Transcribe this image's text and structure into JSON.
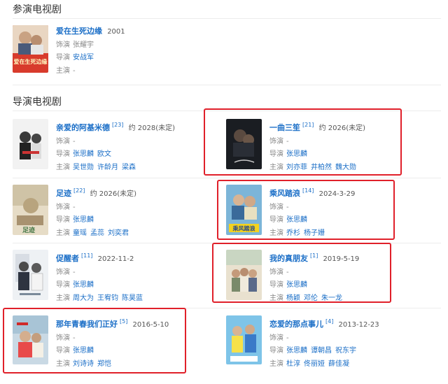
{
  "acted_section": {
    "title": "参演电视剧",
    "items": [
      {
        "title": "爱在生死边缘",
        "year": "2001",
        "cast_label": "饰演",
        "cast": "张耀宇",
        "director_label": "导演",
        "directors": [
          "安战军"
        ],
        "star_label": "主演",
        "stars_empty": "-"
      }
    ]
  },
  "directed_section": {
    "title": "导演电视剧",
    "items": [
      {
        "title": "亲爱的阿基米德",
        "ref": "[23]",
        "date": "约 2028(未定)",
        "role": "-",
        "directors": [
          "张思麟",
          "欧文"
        ],
        "stars": [
          "吴世勋",
          "许龄月",
          "梁森"
        ]
      },
      {
        "title": "一曲三笙",
        "ref": "[21]",
        "date": "约 2026(未定)",
        "role": "-",
        "directors": [
          "张思麟"
        ],
        "stars": [
          "刘亦菲",
          "井柏然",
          "魏大勋"
        ]
      },
      {
        "title": "足迹",
        "ref": "[22]",
        "date": "约 2026(未定)",
        "role": "-",
        "directors": [
          "张思麟"
        ],
        "stars": [
          "童瑶",
          "孟蕊",
          "刘奕君"
        ]
      },
      {
        "title": "乘风踏浪",
        "ref": "[14]",
        "date": "2024-3-29",
        "role": "-",
        "directors": [
          "张思麟"
        ],
        "stars": [
          "乔杉",
          "杨子姗"
        ]
      },
      {
        "title": "促醒者",
        "ref": "[11]",
        "date": "2022-11-2",
        "role": "-",
        "directors": [
          "张思麟"
        ],
        "stars": [
          "周大为",
          "王宥钧",
          "陈昊蓝"
        ]
      },
      {
        "title": "我的真朋友",
        "ref": "[1]",
        "date": "2019-5-19",
        "role": "-",
        "directors": [
          "张思麟"
        ],
        "stars": [
          "杨颖",
          "邓伦",
          "朱一龙"
        ]
      },
      {
        "title": "那年青春我们正好",
        "ref": "[5]",
        "date": "2016-5-10",
        "role": "-",
        "directors": [
          "张思麟"
        ],
        "stars": [
          "刘诗诗",
          "郑恺"
        ]
      },
      {
        "title": "恋爱的那点事儿",
        "ref": "[4]",
        "date": "2013-12-23",
        "role": "-",
        "directors": [
          "张思麟",
          "谭朝昌",
          "祝东宇"
        ],
        "stars": [
          "杜淳",
          "佟丽娅",
          "薛佳凝"
        ]
      }
    ]
  },
  "labels": {
    "cast": "饰演",
    "director": "导演",
    "star": "主演"
  },
  "colors": {
    "link": "#1a6ec7",
    "highlight": "#e0202a",
    "muted": "#888888"
  },
  "poster_icons": [
    "poster-aizai",
    "poster-qinaide",
    "poster-yiqu",
    "poster-zuji",
    "poster-chengfeng",
    "poster-cuxing",
    "poster-zhenpengyou",
    "poster-nanian",
    "poster-lianai"
  ],
  "poster_texts": {
    "aizai": "爱在生死边缘",
    "zuji": "足迹",
    "chengfeng": "乘风踏浪"
  }
}
